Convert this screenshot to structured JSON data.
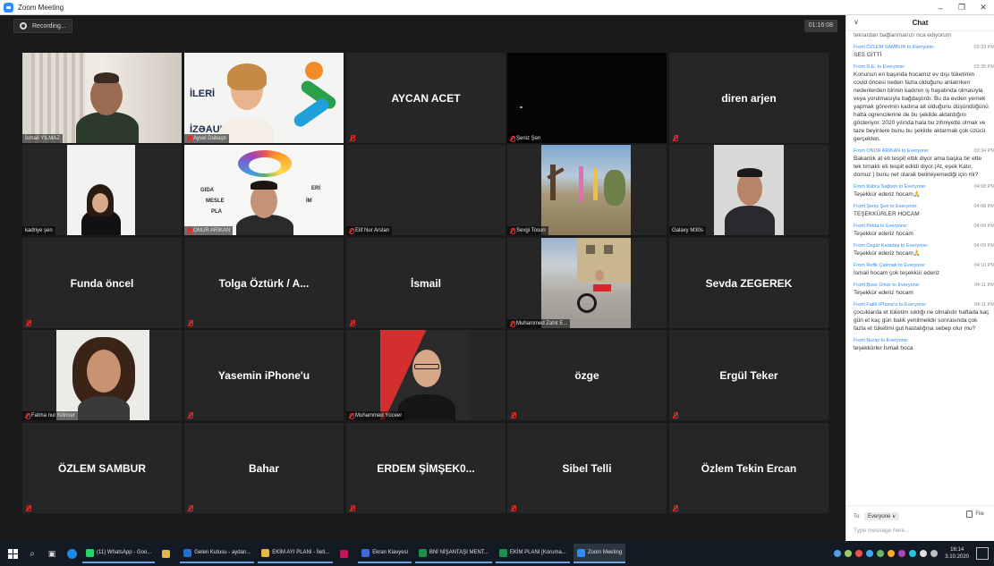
{
  "window": {
    "title": "Zoom Meeting",
    "minimize": "–",
    "restore": "❐",
    "close": "✕"
  },
  "meeting": {
    "recording_label": "Recording...",
    "elapsed": "01:16:08",
    "tiles": [
      {
        "name": "İsmail YILMAZ"
      },
      {
        "name": "Aysel Dabaştı"
      },
      {
        "name": "",
        "center": "AYCAN ACET"
      },
      {
        "name": "Şeniz Şen"
      },
      {
        "name": "",
        "center": "diren arjen"
      },
      {
        "name": "kadriye şen"
      },
      {
        "name": "ONUR ARIKAN"
      },
      {
        "name": "Elif Nur Arslan"
      },
      {
        "name": "Sevgi Tosun"
      },
      {
        "name": "Galaxy M30s"
      },
      {
        "name": "",
        "center": "Funda öncel"
      },
      {
        "name": "",
        "center": "Tolga Öztürk / A..."
      },
      {
        "name": "",
        "center": "İsmail"
      },
      {
        "name": "Muhammed Zahit E..."
      },
      {
        "name": "",
        "center": "Sevda ZEGEREK"
      },
      {
        "name": "Fatma nur Kilincer"
      },
      {
        "name": "",
        "center": "Yasemin iPhone'u"
      },
      {
        "name": "Muhammed Yüceer"
      },
      {
        "name": "",
        "center": "özge"
      },
      {
        "name": "",
        "center": "Ergül Teker"
      },
      {
        "name": "",
        "center": "ÖZLEM SAMBUR"
      },
      {
        "name": "",
        "center": "Bahar"
      },
      {
        "name": "",
        "center": "ERDEM ŞİMŞEK0..."
      },
      {
        "name": "",
        "center": "Sibel Telli"
      },
      {
        "name": "",
        "center": "Özlem Tekin Ercan"
      }
    ],
    "banner_words": {
      "left_top": "İLERİ",
      "left_bottom": "İZƏAUBESİ",
      "gida": "GIDA",
      "meslek": "MESLE",
      "plan": "PLA",
      "eri": "ERİ",
      "im": "İM"
    }
  },
  "chat": {
    "title": "Chat",
    "partial_top": "tekrardan bağlanmanızı rica ediyorum",
    "messages": [
      {
        "from": "From ÖZLEM SAMBUR to Everyone:",
        "time": "03:33 PM",
        "text": "SES GİTTİ"
      },
      {
        "from": "From D.E. to Everyone:",
        "time": "03:35 PM",
        "text": "Konunun en başında hocamız ev dışı tüketimin covid öncesi neden fazla olduğunu anlatırken nedenlerden birinin kadının iş hayatında olmasıyla veya yorulmasıyla bağdaştırdı. Bu da evden yemek yapmak görevinin kadına ait olduğunu düşündüğünü hatta ogrencilerine de bu şekilde aktardığını gösteriyor. 2020 yılında hala bu zihniyette olmak ve taze beyinlere bunu bu şekilde aktarmak çok üzücü gerçekten."
      },
      {
        "from": "From ONUR ARIKAN to Everyone:",
        "time": "03:34 PM",
        "text": "Bakanlık at eti tespit ettik diyor ama başka bir ette tek tırnaklı eti tespit edildi diyor.(At, eşek Katır, domuz ) bunu net olarak belirleyemediği için mi?"
      },
      {
        "from": "From Kübra Sağlam to Everyone:",
        "time": "04:08 PM",
        "text": "Teşekkür ederiz hocam🙏"
      },
      {
        "from": "From Şeniz Şen to Everyone:",
        "time": "04:08 PM",
        "text": "TEŞEKKÜRLER HOCAM"
      },
      {
        "from": "From Pelda to Everyone:",
        "time": "04:09 PM",
        "text": "Teşekkür ederiz hocam"
      },
      {
        "from": "From Özgür Karadaş to Everyone:",
        "time": "04:09 PM",
        "text": "Teşekkür ederiz hocam🙏"
      },
      {
        "from": "From Refik Çakmak to Everyone:",
        "time": "04:10 PM",
        "text": "İsmail hocam çok teşekkür ederiz"
      },
      {
        "from": "From Buse Ürker to Everyone:",
        "time": "04:11 PM",
        "text": "Teşekkür ederiz hocam"
      },
      {
        "from": "From Fatih iPhone'u to Everyone:",
        "time": "04:11 PM",
        "text": "çocuklarda et tüketim sıklığı ne olmalıdır haftada kaç gün et kaç gün balık yenilmelidir sonrasında çok fazla et tüketimi gut hastalığına sebep olur mu?"
      },
      {
        "from": "From Nuray to Everyone:",
        "time": "",
        "text": "teşekkürler İsmail hoca"
      }
    ],
    "to_label": "To:",
    "to_value": "Everyone ∨",
    "file_label": "File",
    "input_placeholder": "Type message here..."
  },
  "taskbar": {
    "apps": [
      {
        "label": "(11) WhatsApp - Goo...",
        "color": "#25d366"
      },
      {
        "label": "",
        "color": "#e6b84a"
      },
      {
        "label": "Gelen Kutusu - aydan...",
        "color": "#1e6fd9"
      },
      {
        "label": "EKİM AYI PLANI - İleti...",
        "color": "#e6b84a"
      },
      {
        "label": "",
        "color": "#c2185b"
      },
      {
        "label": "Ekran Klavyesi",
        "color": "#3f6ad8"
      },
      {
        "label": "BNİ NİŞANTAŞI MENT...",
        "color": "#1f8f4e"
      },
      {
        "label": "EKİM PLANI [Koruma...",
        "color": "#1f8f4e"
      },
      {
        "label": "Zoom Meeting",
        "color": "#2d8cff"
      }
    ],
    "clock_time": "16:14",
    "clock_date": "3.10.2020"
  }
}
